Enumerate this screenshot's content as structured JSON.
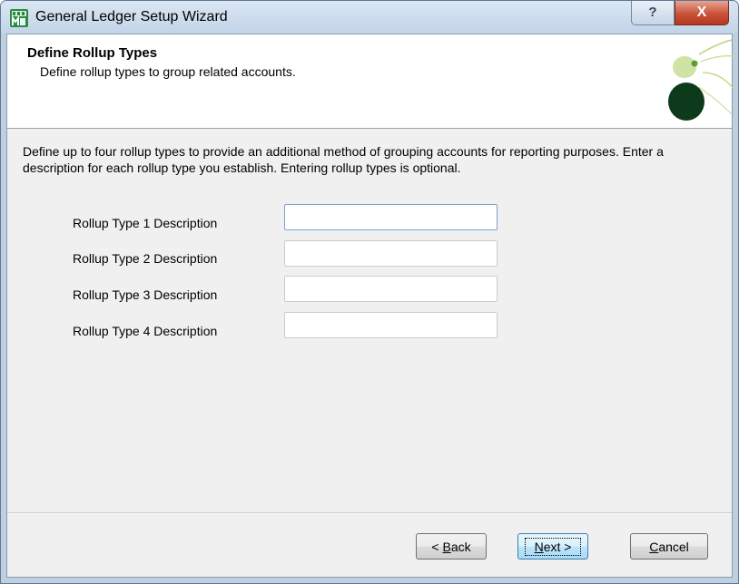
{
  "window": {
    "title": "General Ledger Setup Wizard",
    "help_label": "?",
    "close_label": "X"
  },
  "header": {
    "title": "Define Rollup Types",
    "subtitle": "Define rollup types to group related accounts."
  },
  "instructions": "Define up to four rollup types to provide an additional method of grouping accounts for reporting purposes.  Enter a description for each rollup type you establish.  Entering rollup types is optional.",
  "rollup_fields": [
    {
      "label": "Rollup Type 1 Description",
      "value": ""
    },
    {
      "label": "Rollup Type 2 Description",
      "value": ""
    },
    {
      "label": "Rollup Type 3 Description",
      "value": ""
    },
    {
      "label": "Rollup Type 4 Description",
      "value": ""
    }
  ],
  "buttons": {
    "back_prefix": "< ",
    "back_key": "B",
    "back_rest": "ack",
    "next_key": "N",
    "next_rest": "ext >",
    "cancel_key": "C",
    "cancel_rest": "ancel"
  },
  "colors": {
    "titlebar": "#c2d4e8",
    "close_button": "#c9523a",
    "dialog_background": "#f0f0f0",
    "logo_dark": "#0e3a1c",
    "logo_light": "#a8cc5a"
  }
}
